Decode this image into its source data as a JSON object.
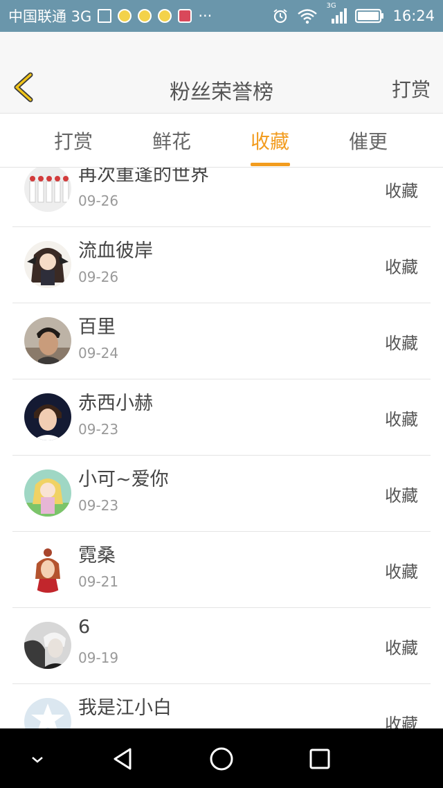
{
  "status_bar": {
    "carrier": "中国联通 3G",
    "more_indicator": "···",
    "network_label": "3G",
    "time": "16:24",
    "icons": [
      "image-icon",
      "bulb-icon",
      "bulb-icon",
      "bulb-icon",
      "huawei-app-icon",
      "alarm-icon",
      "wifi-icon",
      "signal-icon",
      "battery-icon"
    ]
  },
  "header": {
    "back_icon": "chevron-left-icon",
    "title": "粉丝荣誉榜",
    "action_label": "打赏"
  },
  "tabs": [
    {
      "label": "打赏",
      "active": false
    },
    {
      "label": "鲜花",
      "active": false
    },
    {
      "label": "收藏",
      "active": true
    },
    {
      "label": "催更",
      "active": false
    }
  ],
  "accent_color": "#f29c1f",
  "list": [
    {
      "name": "再次重逢的世界",
      "date": "09-26",
      "action": "收藏"
    },
    {
      "name": "流血彼岸",
      "date": "09-26",
      "action": "收藏"
    },
    {
      "name": "百里",
      "date": "09-24",
      "action": "收藏"
    },
    {
      "name": "赤西小赫",
      "date": "09-23",
      "action": "收藏"
    },
    {
      "name": "小可~爱你",
      "date": "09-23",
      "action": "收藏"
    },
    {
      "name": "霓桑",
      "date": "09-21",
      "action": "收藏"
    },
    {
      "name": "6",
      "date": "09-19",
      "action": "收藏"
    },
    {
      "name": "我是江小白",
      "date": "",
      "action": "收藏"
    }
  ],
  "nav_bar": {
    "icons": [
      "hide-keyboard-icon",
      "back-triangle-icon",
      "home-circle-icon",
      "recents-square-icon"
    ]
  }
}
